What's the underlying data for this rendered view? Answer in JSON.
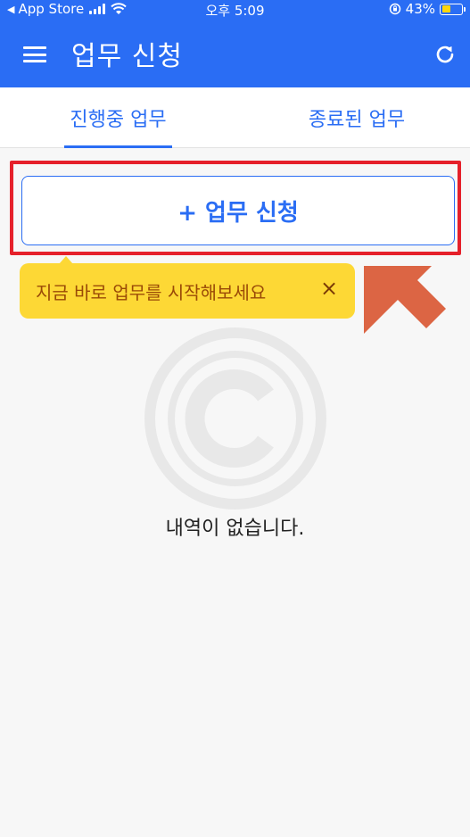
{
  "status_bar": {
    "back_label": "App Store",
    "time": "오후 5:09",
    "battery": "43%"
  },
  "header": {
    "title": "업무 신청",
    "menu_icon": "hamburger-icon",
    "refresh_icon": "refresh-icon"
  },
  "tabs": [
    {
      "label": "진행중 업무",
      "active": true
    },
    {
      "label": "종료된 업무",
      "active": false
    }
  ],
  "request_button": {
    "label": "+ 업무 신청"
  },
  "tooltip": {
    "text": "지금 바로 업무를 시작해보세요",
    "close_label": "×"
  },
  "empty_state": {
    "message": "내역이 없습니다.",
    "icon": "copyright-icon"
  },
  "colors": {
    "primary": "#2a6df4",
    "highlight": "#e5202a",
    "tooltip_bg": "#fdd835",
    "arrow": "#dc6544"
  }
}
